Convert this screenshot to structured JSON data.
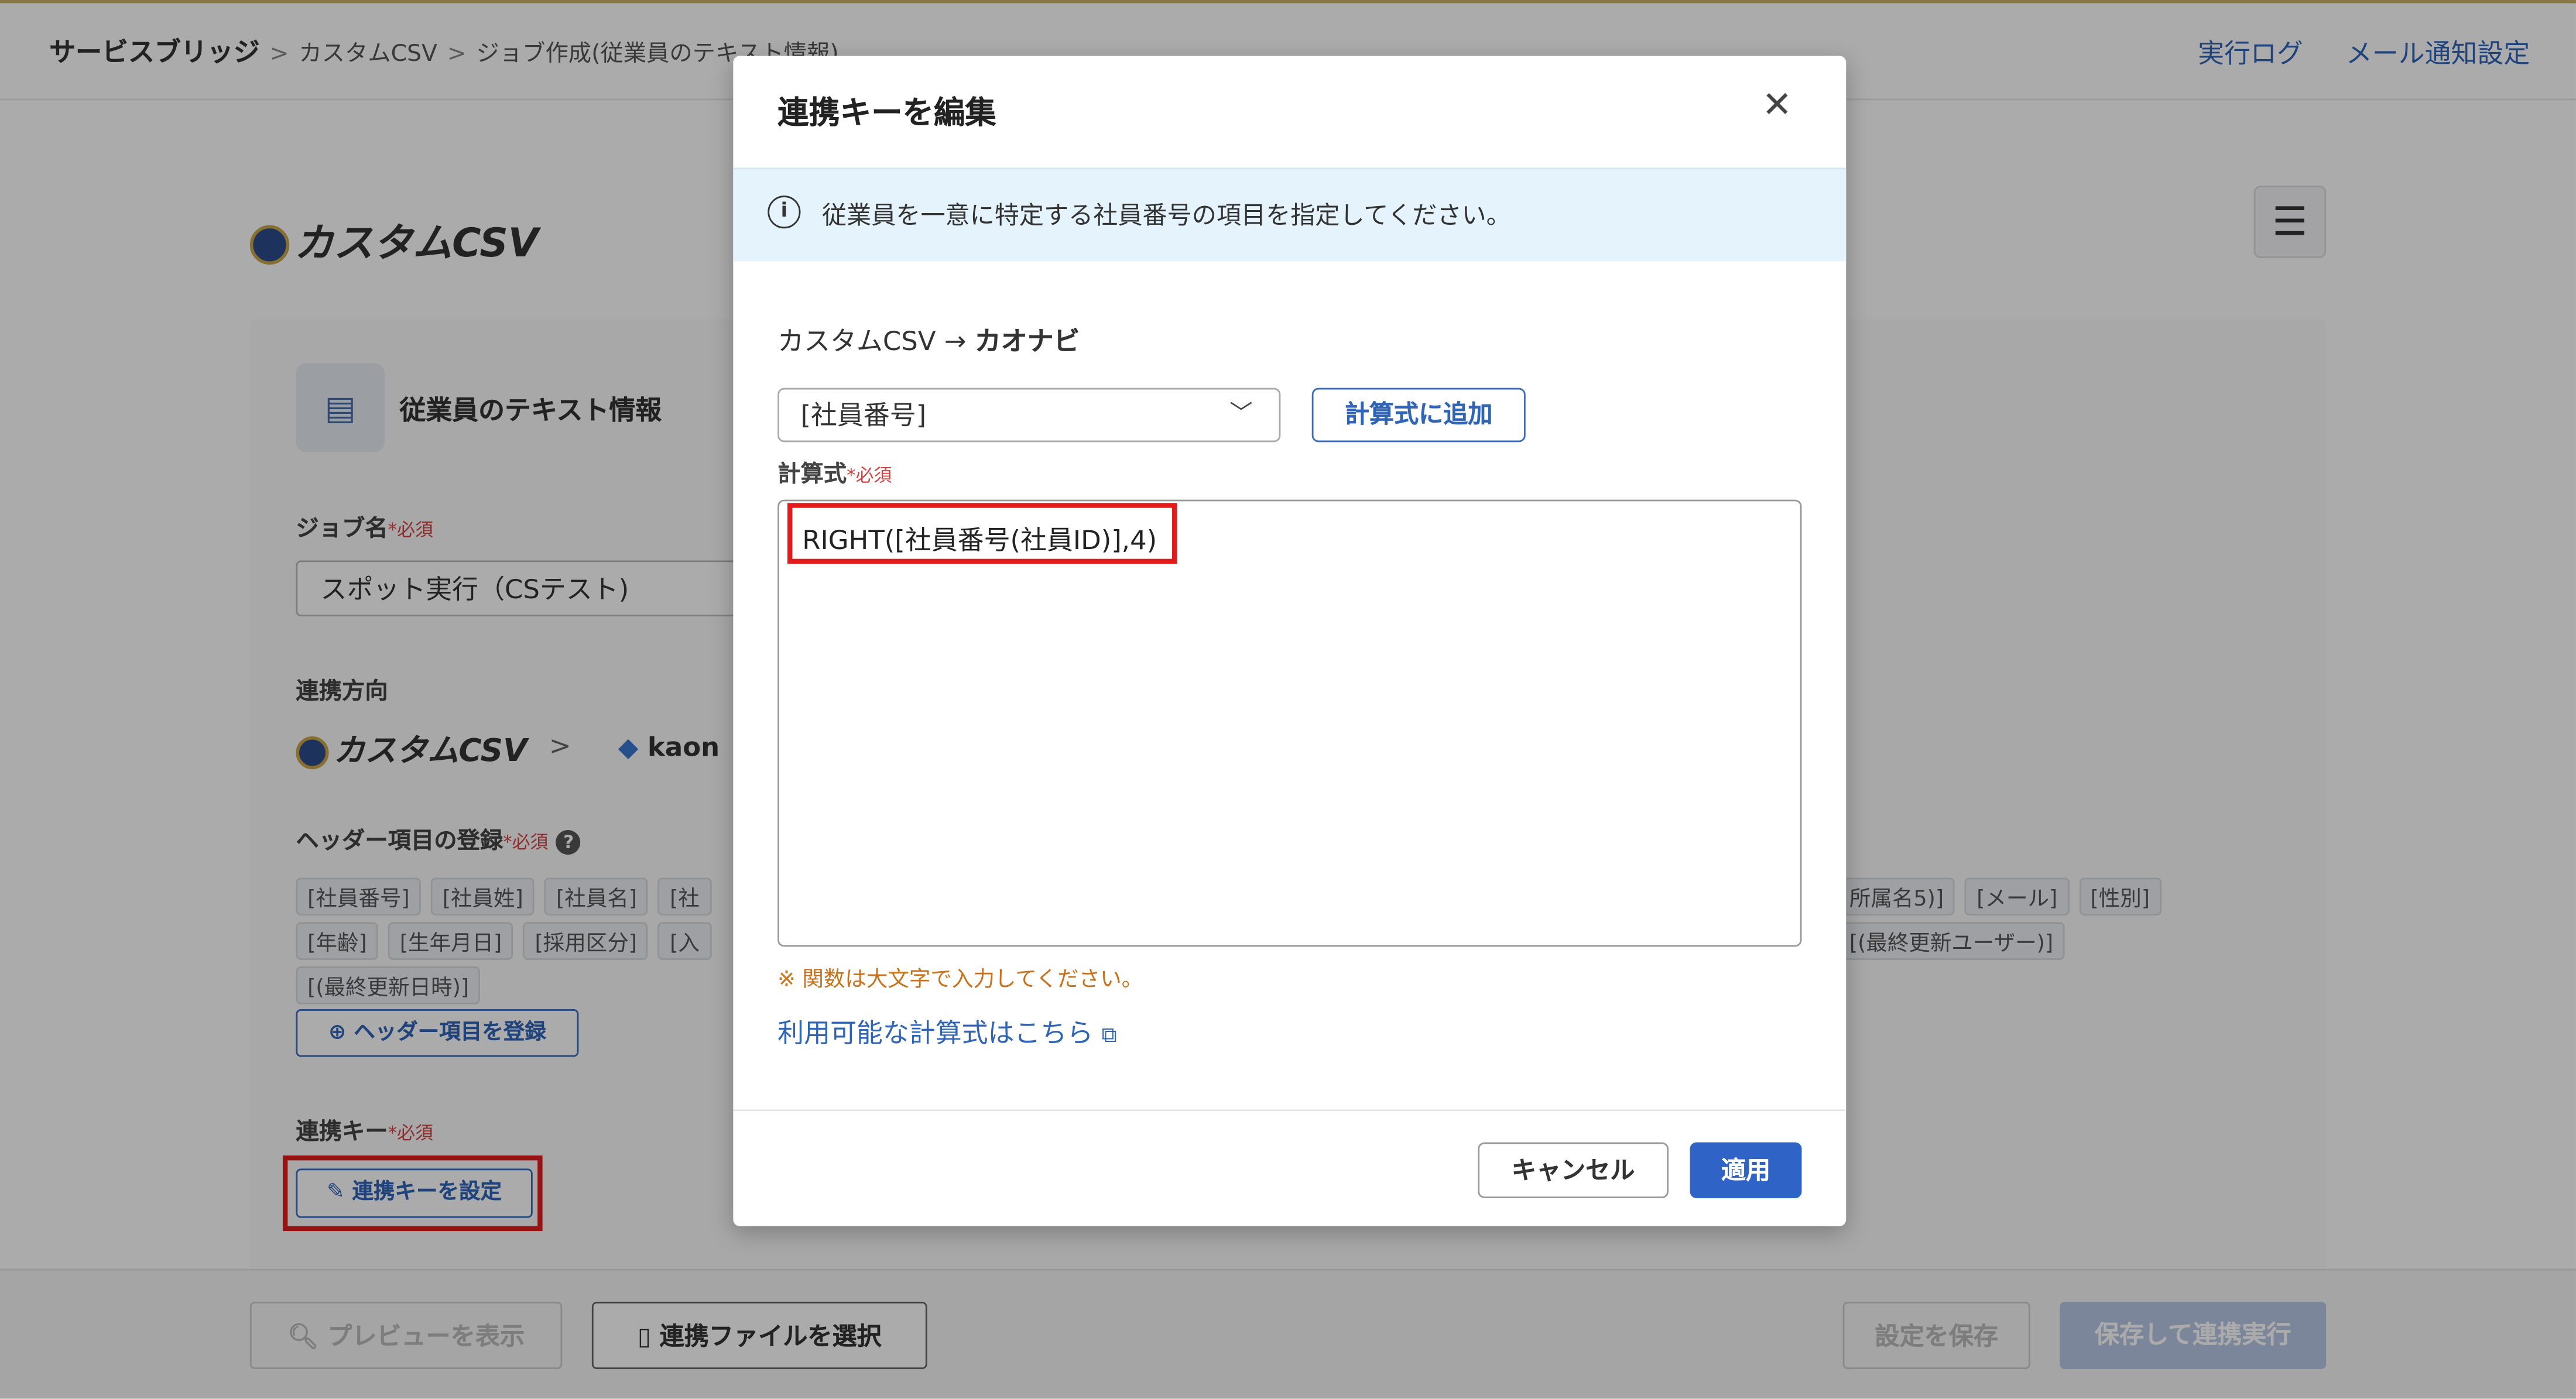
{
  "breadcrumb": {
    "root": "サービスブリッジ",
    "level2": "カスタムCSV",
    "level3": "ジョブ作成(従業員のテキスト情報)"
  },
  "top_links": {
    "log": "実行ログ",
    "mail": "メール通知設定"
  },
  "logo_text": "カスタムCSV",
  "job": {
    "title": "従業員のテキスト情報",
    "name_label": "ジョブ名",
    "required": "*必須",
    "name_value": "スポット実行（CSテスト)",
    "direction_label": "連携方向",
    "direction_from": "カスタムCSV",
    "direction_to": "kaon",
    "header_label": "ヘッダー項目の登録",
    "header_tags_left": [
      "[社員番号]",
      "[社員姓]",
      "[社員名]",
      "[社",
      "[年齢]",
      "[生年月日]",
      "[採用区分]",
      "[入",
      "[(最終更新日時)]"
    ],
    "header_tags_right": [
      "所属名5)]",
      "[メール]",
      "[性別]",
      "[(最終更新ユーザー)]"
    ],
    "register_header_button": "ヘッダー項目を登録",
    "key_label": "連携キー",
    "set_key_button": "連携キーを設定"
  },
  "footer": {
    "preview": "プレビューを表示",
    "select_file": "連携ファイルを選択",
    "save": "設定を保存",
    "save_run": "保存して連携実行"
  },
  "modal": {
    "title": "連携キーを編集",
    "info": "従業員を一意に特定する社員番号の項目を指定してください。",
    "route_from": "カスタムCSV",
    "route_arrow": "→",
    "route_to": "カオナビ",
    "select_value": "[社員番号]",
    "add_button": "計算式に追加",
    "formula_label": "計算式",
    "formula_required": "*必須",
    "formula_value": "RIGHT([社員番号(社員ID)],4)",
    "note": "※ 関数は大文字で入力してください。",
    "link": "利用可能な計算式はこちら",
    "cancel": "キャンセル",
    "apply": "適用"
  },
  "icons": [
    "globe-icon",
    "menu-icon",
    "document-icon",
    "help-icon",
    "plus-circle-icon",
    "pencil-icon",
    "search-doc-icon",
    "csv-file-icon",
    "close-icon",
    "info-icon",
    "chevron-down-icon",
    "external-link-icon"
  ]
}
